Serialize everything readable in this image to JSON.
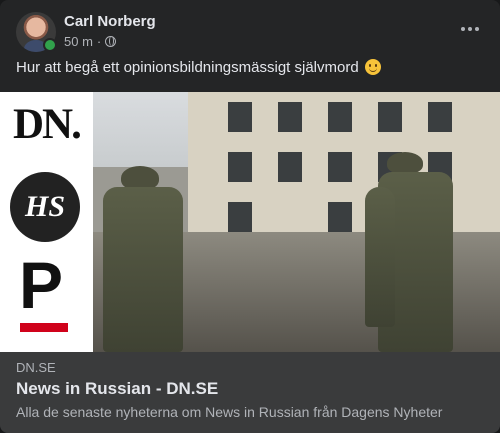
{
  "post": {
    "author": "Carl Norberg",
    "time": "50 m",
    "separator": "·",
    "privacy_icon": "globe-icon",
    "text": "Hur att begå ett opinionsbildningsmässigt självmord",
    "emoji": "slightly-smiling-face"
  },
  "media": {
    "logos": {
      "dn": "DN.",
      "hs": "HS",
      "p": "P"
    },
    "photo_alt": "Soldiers walking past a destroyed building"
  },
  "link_preview": {
    "domain": "DN.SE",
    "title": "News in Russian - DN.SE",
    "description": "Alla de senaste nyheterna om News in Russian från Dagens Nyheter"
  },
  "colors": {
    "card_bg": "#242526",
    "link_bg": "#3a3b3c",
    "online": "#31a24c",
    "p_logo_bar": "#d0021b"
  }
}
